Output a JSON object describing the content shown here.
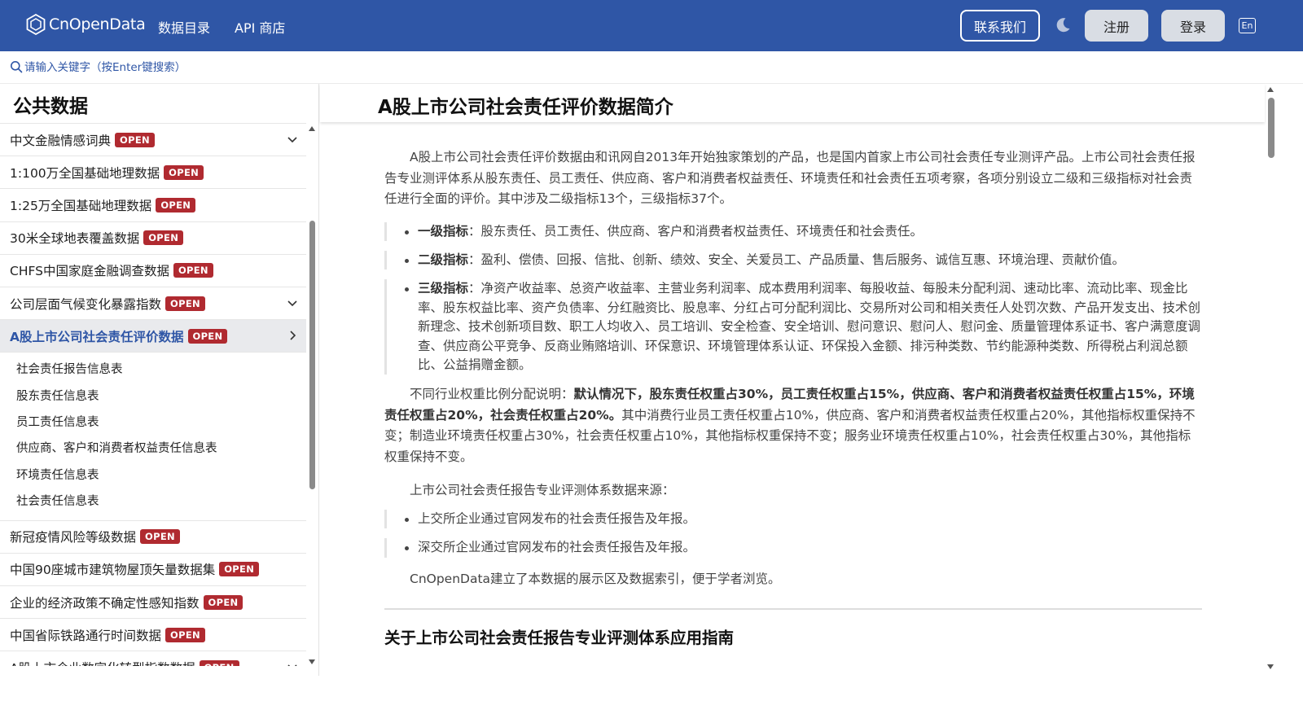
{
  "header": {
    "logo_text": "CnOpenData",
    "nav": [
      "数据目录",
      "API 商店"
    ],
    "contact_label": "联系我们",
    "register_label": "注册",
    "login_label": "登录",
    "lang_label": "En",
    "theme_icon": "moon-icon",
    "brand_color": "#2f56a6"
  },
  "search": {
    "placeholder": "请输入关键字（按Enter键搜索）"
  },
  "sidebar": {
    "title": "公共数据",
    "badge_label": "OPEN",
    "badge_color": "#b02a30",
    "items_before": [
      {
        "label": "中文金融情感词典",
        "chevron": "chevron-down-icon"
      },
      {
        "label": "1:100万全国基础地理数据"
      },
      {
        "label": "1:25万全国基础地理数据"
      },
      {
        "label": "30米全球地表覆盖数据"
      },
      {
        "label": "CHFS中国家庭金融调查数据"
      },
      {
        "label": "公司层面气候变化暴露指数",
        "chevron": "chevron-down-icon"
      }
    ],
    "active_item": {
      "label": "A股上市公司社会责任评价数据",
      "chevron": "chevron-right-icon"
    },
    "sub_items": [
      "社会责任报告信息表",
      "股东责任信息表",
      "员工责任信息表",
      "供应商、客户和消费者权益责任信息表",
      "环境责任信息表",
      "社会责任信息表"
    ],
    "items_after": [
      {
        "label": "新冠疫情风险等级数据"
      },
      {
        "label": "中国90座城市建筑物屋顶矢量数据集"
      },
      {
        "label": "企业的经济政策不确定性感知指数"
      },
      {
        "label": "中国省际铁路通行时间数据"
      },
      {
        "label": "A股上市企业数字化转型指数数据",
        "chevron": "chevron-down-icon"
      }
    ]
  },
  "content": {
    "title": "A股上市公司社会责任评价数据简介",
    "intro": "A股上市公司社会责任评价数据由和讯网自2013年开始独家策划的产品，也是国内首家上市公司社会责任专业测评产品。上市公司社会责任报告专业测评体系从股东责任、员工责任、供应商、客户和消费者权益责任、环境责任和社会责任五项考察，各项分别设立二级和三级指标对社会责任进行全面的评价。其中涉及二级指标13个，三级指标37个。",
    "indicators": [
      {
        "label": "一级指标",
        "text": "：股东责任、员工责任、供应商、客户和消费者权益责任、环境责任和社会责任。"
      },
      {
        "label": "二级指标",
        "text": "：盈利、偿债、回报、信批、创新、绩效、安全、关爱员工、产品质量、售后服务、诚信互惠、环境治理、贡献价值。"
      },
      {
        "label": "三级指标",
        "text": "：净资产收益率、总资产收益率、主营业务利润率、成本费用利润率、每股收益、每股未分配利润、速动比率、流动比率、现金比率、股东权益比率、资产负债率、分红融资比、股息率、分红占可分配利润比、交易所对公司和相关责任人处罚次数、产品开发支出、技术创新理念、技术创新项目数、职工人均收入、员工培训、安全检查、安全培训、慰问意识、慰问人、慰问金、质量管理体系证书、客户满意度调查、供应商公平竞争、反商业贿赂培训、环保意识、环境管理体系认证、环保投入金额、排污种类数、节约能源种类数、所得税占利润总额比、公益捐赠金额。"
      }
    ],
    "weight_intro": "不同行业权重比例分配说明：",
    "weight_bold": "默认情况下，股东责任权重占30%，员工责任权重占15%，供应商、客户和消费者权益责任权重占15%，环境责任权重占20%，社会责任权重占20%。",
    "weight_rest": "其中消费行业员工责任权重占10%，供应商、客户和消费者权益责任权重占20%，其他指标权重保持不变；制造业环境责任权重占30%，社会责任权重占10%，其他指标权重保持不变；服务业环境责任权重占10%，社会责任权重占30%，其他指标权重保持不变。",
    "source_intro": "上市公司社会责任报告专业评测体系数据来源：",
    "sources": [
      "上交所企业通过官网发布的社会责任报告及年报。",
      "深交所企业通过官网发布的社会责任报告及年报。"
    ],
    "closing": "CnOpenData建立了本数据的展示区及数据索引，便于学者浏览。",
    "section_title": "关于上市公司社会责任报告专业评测体系应用指南"
  }
}
